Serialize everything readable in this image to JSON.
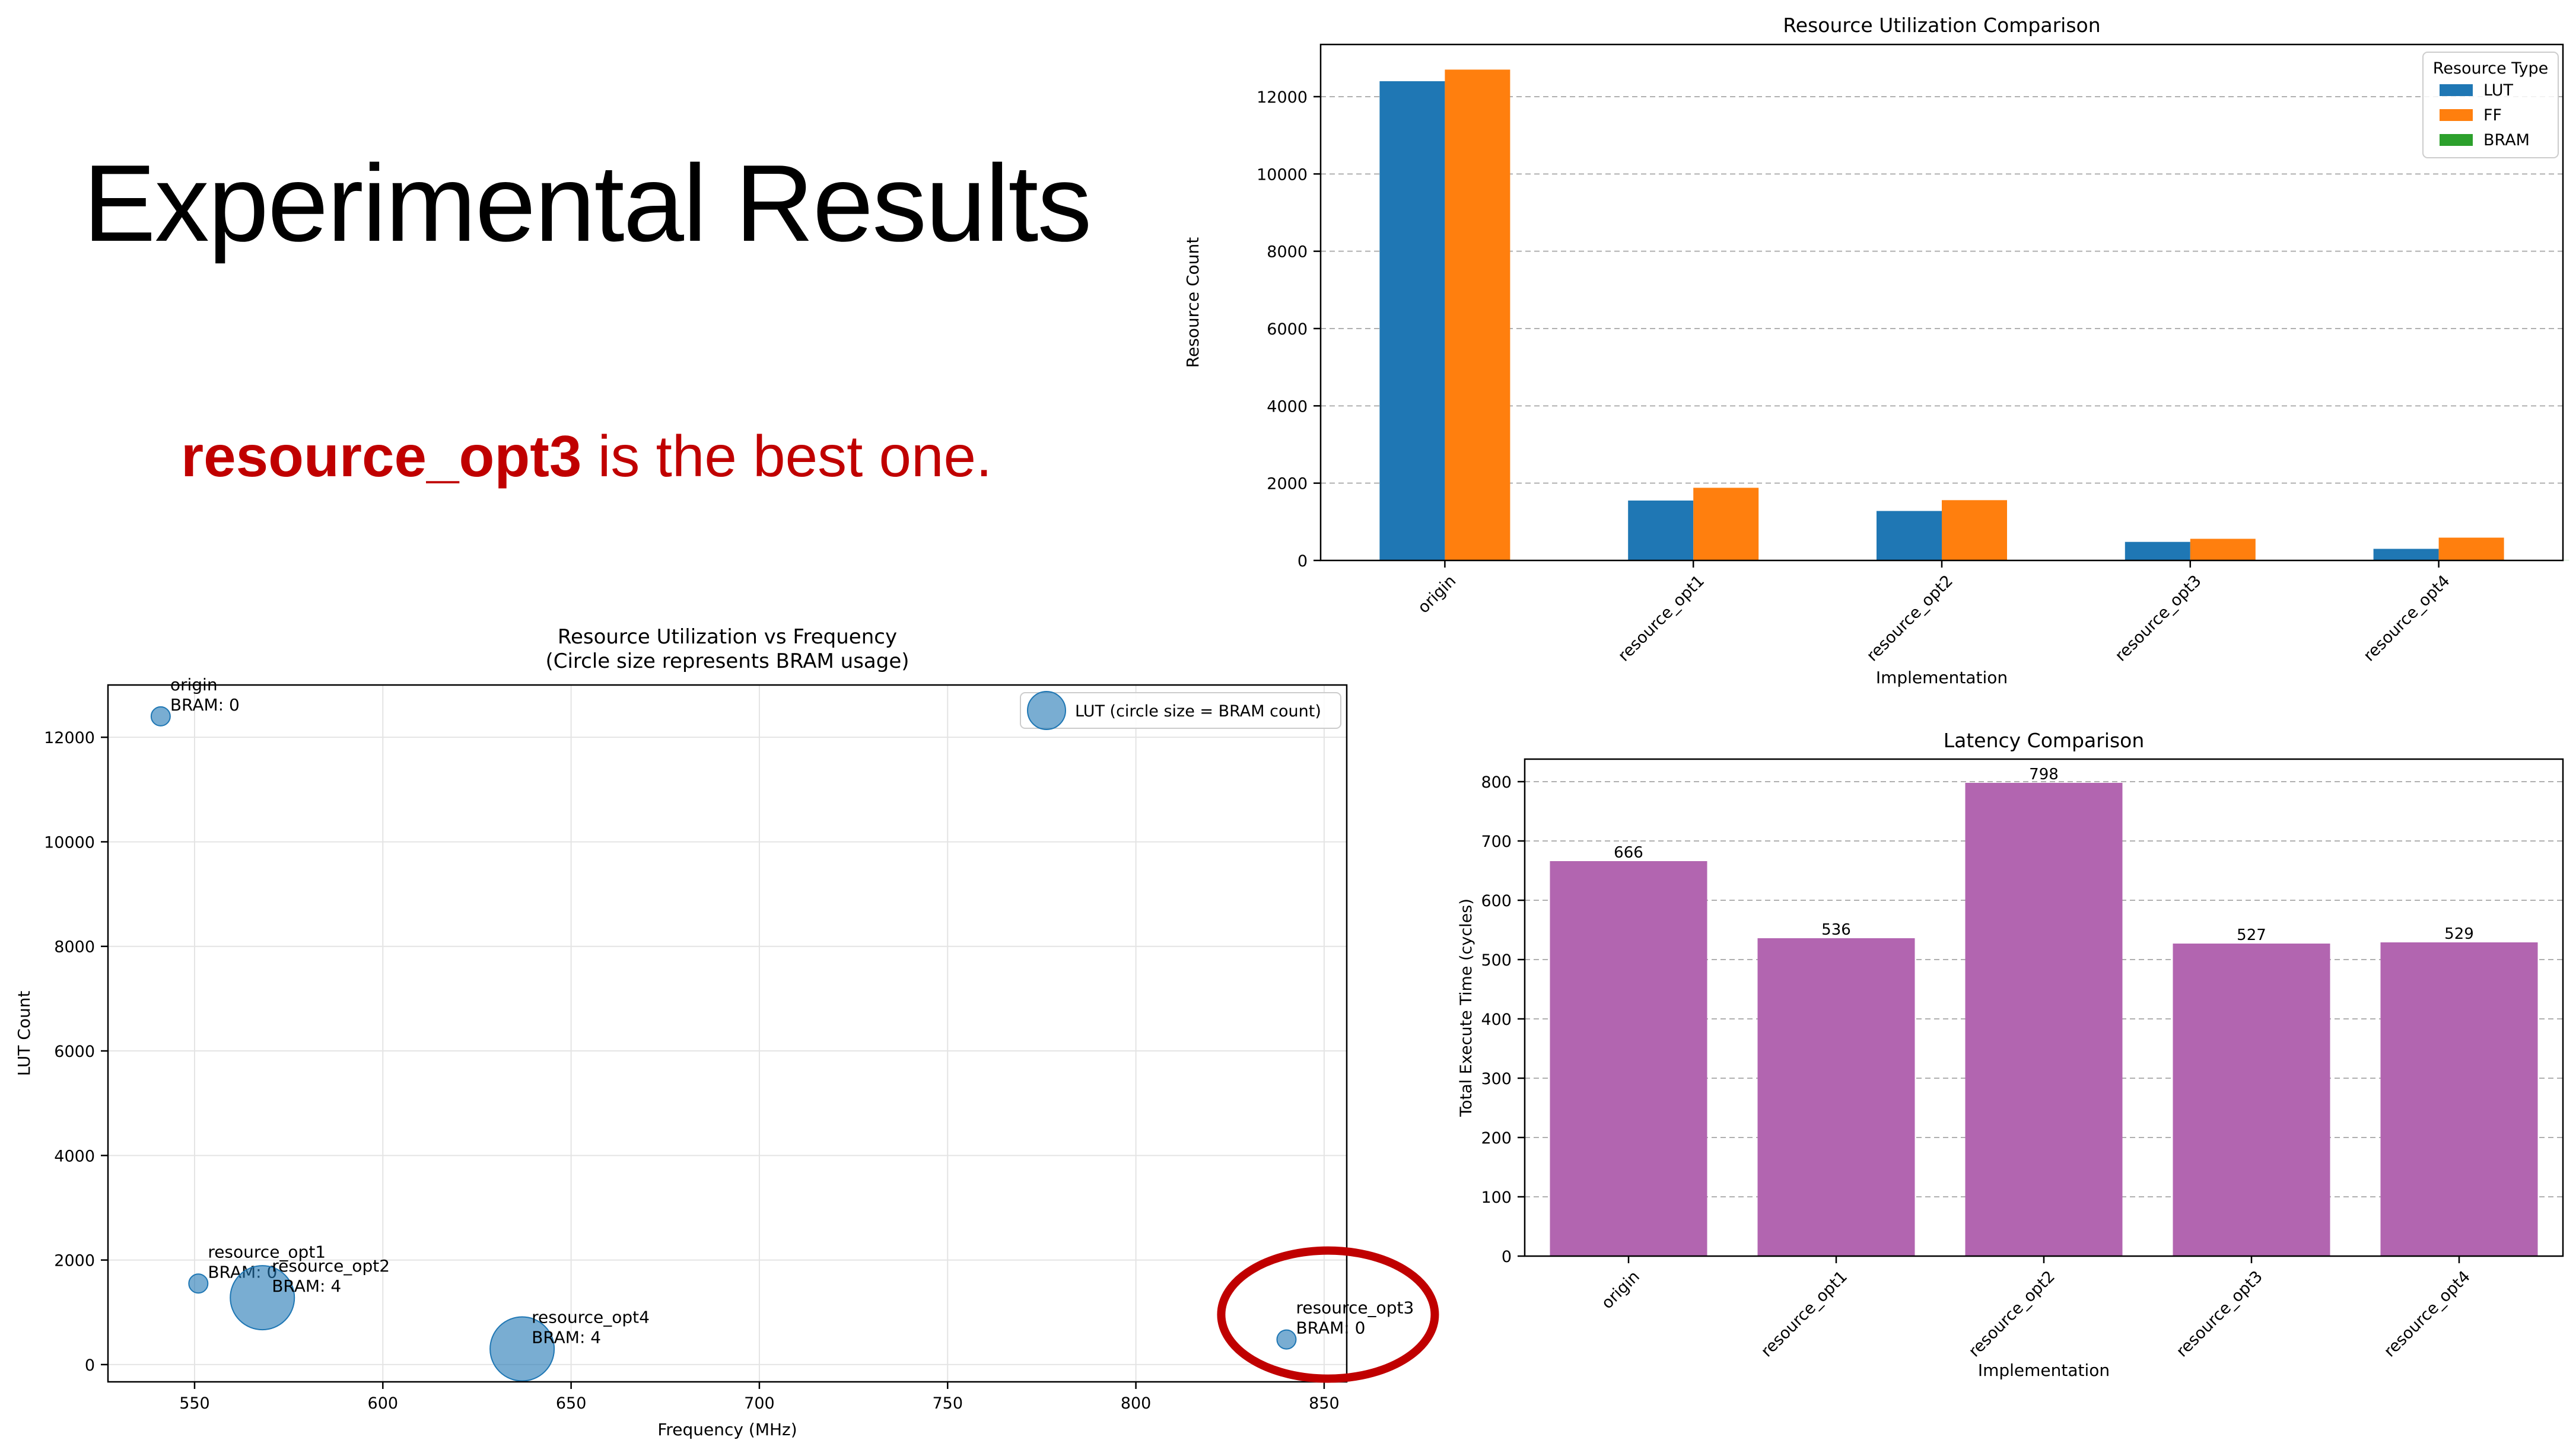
{
  "slide": {
    "title": "Experimental Results",
    "conclusion_bold": "resource_opt3",
    "conclusion_rest": " is the best one.",
    "accent_color": "#c00000"
  },
  "chart_data": [
    {
      "id": "resource",
      "type": "bar",
      "title": "Resource Utilization Comparison",
      "xlabel": "Implementation",
      "ylabel": "Resource Count",
      "categories": [
        "origin",
        "resource_opt1",
        "resource_opt2",
        "resource_opt3",
        "resource_opt4"
      ],
      "series": [
        {
          "name": "LUT",
          "color": "#1f77b4",
          "values": [
            12400,
            1550,
            1280,
            480,
            300
          ]
        },
        {
          "name": "FF",
          "color": "#ff7f0e",
          "values": [
            12700,
            1880,
            1560,
            560,
            590
          ]
        },
        {
          "name": "BRAM",
          "color": "#2ca02c",
          "values": [
            0,
            4,
            4,
            0,
            4
          ]
        }
      ],
      "ylim": [
        0,
        13350
      ],
      "yticks": [
        0,
        2000,
        4000,
        6000,
        8000,
        10000,
        12000
      ],
      "legend_title": "Resource Type",
      "legend_position": "top-right",
      "grid": "y-dashed"
    },
    {
      "id": "scatter",
      "type": "scatter",
      "title": "Resource Utilization vs Frequency",
      "subtitle": "(Circle size represents BRAM usage)",
      "xlabel": "Frequency (MHz)",
      "ylabel": "LUT Count",
      "color": "#1f77b4",
      "points": [
        {
          "name": "origin",
          "x": 541,
          "y": 12400,
          "bram": 0,
          "note": "BRAM: 0"
        },
        {
          "name": "resource_opt1",
          "x": 551,
          "y": 1550,
          "bram": 0,
          "note": "BRAM: 0"
        },
        {
          "name": "resource_opt2",
          "x": 568,
          "y": 1280,
          "bram": 4,
          "note": "BRAM: 4"
        },
        {
          "name": "resource_opt4",
          "x": 637,
          "y": 300,
          "bram": 4,
          "note": "BRAM: 4"
        },
        {
          "name": "resource_opt3",
          "x": 840,
          "y": 480,
          "bram": 0,
          "note": "BRAM: 0"
        }
      ],
      "xlim": [
        527,
        856
      ],
      "ylim": [
        -330,
        13000
      ],
      "xticks": [
        550,
        600,
        650,
        700,
        750,
        800,
        850
      ],
      "yticks": [
        0,
        2000,
        4000,
        6000,
        8000,
        10000,
        12000
      ],
      "legend": "LUT (circle size = BRAM count)",
      "legend_position": "top-right",
      "grid": "solid",
      "highlight": "resource_opt3",
      "highlight_color": "#c00000"
    },
    {
      "id": "latency",
      "type": "bar",
      "title": "Latency Comparison",
      "xlabel": "Implementation",
      "ylabel": "Total Execute Time (cycles)",
      "categories": [
        "origin",
        "resource_opt1",
        "resource_opt2",
        "resource_opt3",
        "resource_opt4"
      ],
      "values": [
        666,
        536,
        798,
        527,
        529
      ],
      "color": "#b265b0",
      "ylim": [
        0,
        838
      ],
      "yticks": [
        0,
        100,
        200,
        300,
        400,
        500,
        600,
        700,
        800
      ],
      "grid": "y-dashed"
    }
  ]
}
